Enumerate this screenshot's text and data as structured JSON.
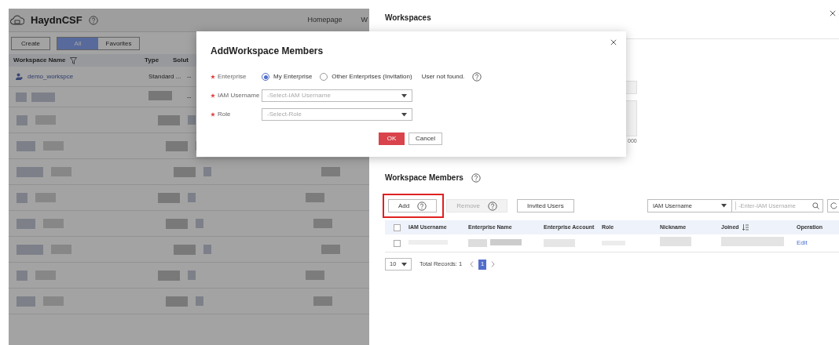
{
  "background_page": {
    "app_name": "HaydnCSF",
    "nav": [
      "Homepage",
      "W"
    ],
    "create_button": "Create",
    "view_tabs": [
      {
        "label": "All",
        "selected": true
      },
      {
        "label": "Favorites",
        "selected": false
      }
    ],
    "columns": [
      "Workspace Name",
      "Type",
      "Solut"
    ],
    "rows": [
      {
        "name": "demo_workspce",
        "type": "Standard ...",
        "column_3": "--"
      },
      {
        "column_3": "--"
      }
    ]
  },
  "drawer": {
    "title": "Workspaces",
    "partial_text": "000",
    "members_title": "Workspace Members",
    "buttons": [
      {
        "label": "Add",
        "disabled": false,
        "highlighted": true
      },
      {
        "label": "Remove",
        "disabled": true,
        "highlighted": false
      },
      {
        "label": "Invited Users",
        "disabled": false,
        "highlighted": false
      }
    ],
    "filter": {
      "field": "IAM Username",
      "placeholder": "-Enter-IAM Username"
    },
    "all_checked": false,
    "columns": [
      "IAM Username",
      "Enterprise Name",
      "Enterprise Account",
      "Role",
      "Nickname",
      "Joined",
      "Operation"
    ],
    "rows": [
      {
        "checked": false,
        "operation": "Edit"
      }
    ],
    "page_size": "10",
    "total": "Total Records: 1",
    "pages": [
      {
        "label": "1",
        "selected": true
      }
    ]
  },
  "dialog": {
    "title": "AddWorkspace Members",
    "fields": [
      {
        "kind": "radio",
        "label": "Enterprise",
        "required": true,
        "options": [
          {
            "label": "My Enterprise",
            "selected": true
          },
          {
            "label": "Other Enterprises (Invitation)",
            "selected": false
          }
        ],
        "note": "User not found."
      },
      {
        "kind": "select",
        "label": "IAM Username",
        "required": true,
        "placeholder": "-Select-IAM Username"
      },
      {
        "kind": "select",
        "label": "Role",
        "required": true,
        "placeholder": "-Select-Role"
      }
    ],
    "buttons": [
      {
        "label": "OK",
        "kind": "primary"
      },
      {
        "label": "Cancel",
        "kind": "secondary"
      }
    ]
  }
}
